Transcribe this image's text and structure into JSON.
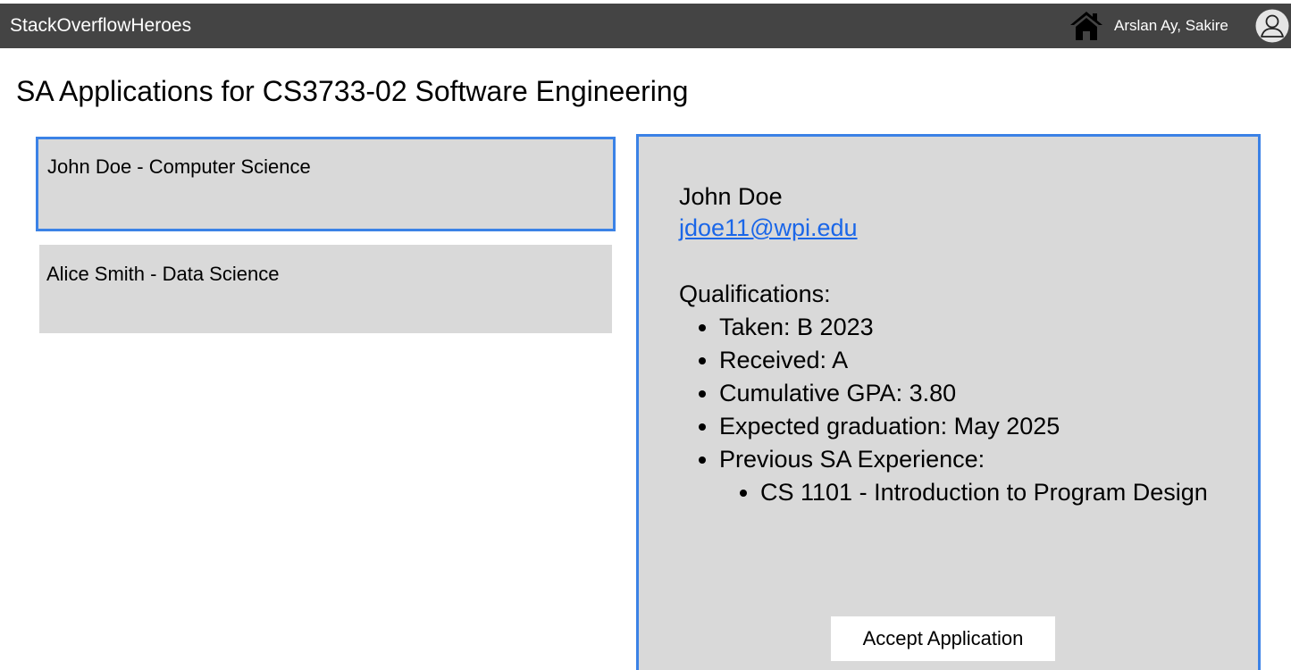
{
  "header": {
    "brand": "StackOverflowHeroes",
    "home_icon": "home-icon",
    "user_name": "Arslan Ay, Sakire",
    "avatar_icon": "user-avatar-icon",
    "bg_color": "#444444"
  },
  "page": {
    "title": "SA Applications for CS3733-02 Software Engineering"
  },
  "applications": [
    {
      "label": "John Doe - Computer Science",
      "selected": true
    },
    {
      "label": "Alice Smith - Data Science",
      "selected": false
    }
  ],
  "detail": {
    "name": "John Doe",
    "email": "jdoe11@wpi.edu",
    "qualifications_heading": "Qualifications:",
    "qualifications": [
      "Taken: B 2023",
      "Received: A",
      "Cumulative GPA: 3.80",
      "Expected graduation: May 2025",
      "Previous SA Experience:"
    ],
    "previous_experience": [
      "CS 1101 - Introduction to Program Design"
    ],
    "accept_label": "Accept Application"
  },
  "colors": {
    "accent": "#3b82e6",
    "card_bg": "#d9d9d9",
    "link": "#1a66e8"
  }
}
